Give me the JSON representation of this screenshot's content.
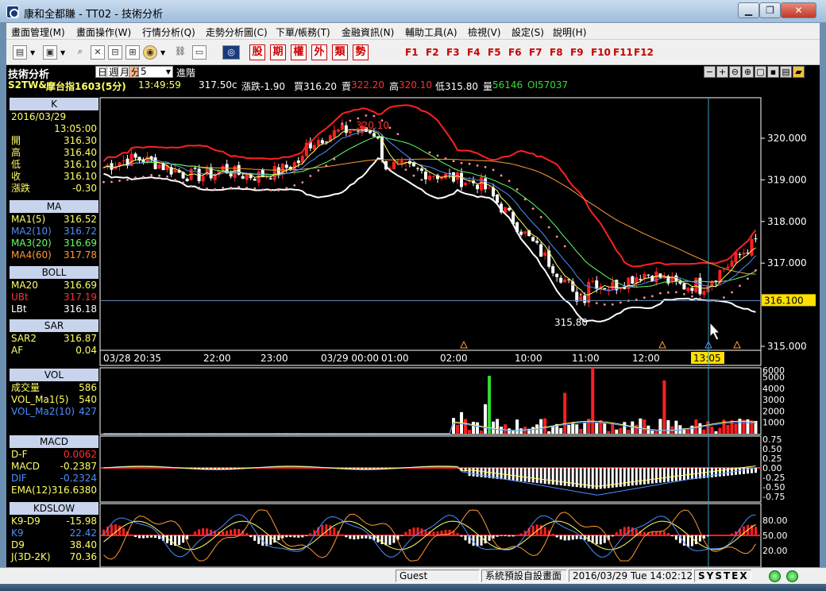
{
  "window": {
    "title": "康和全都賺 - TT02 - 技術分析"
  },
  "menu": [
    "畫面管理(M)",
    "畫面操作(W)",
    "行情分析(Q)",
    "走勢分析圖(C)",
    "下單/帳務(T)",
    "金融資訊(N)",
    "輔助工具(A)",
    "檢視(V)",
    "設定(S)",
    "說明(H)"
  ],
  "toolbar": {
    "red_buttons": [
      "股",
      "期",
      "權",
      "外",
      "類",
      "勢"
    ],
    "fkeys": [
      "F1",
      "F2",
      "F3",
      "F4",
      "F5",
      "F6",
      "F7",
      "F8",
      "F9",
      "F10",
      "F11",
      "F12"
    ]
  },
  "chart_header": {
    "label": "技術分析",
    "periods": [
      "日",
      "週",
      "月",
      "分"
    ],
    "active_period": "分",
    "period_value": "5",
    "advanced": "進階"
  },
  "quote": {
    "symbol": "S2TW&",
    "name": "摩台指1603(5分)",
    "time": "13:49:59",
    "price": "317.50c",
    "change": "漲跌-1.90",
    "bid": "買316.20",
    "ask_label": "賣",
    "ask": "322.20",
    "high_label": "高",
    "high": "320.10",
    "low": "低315.80",
    "vol_label": "量",
    "vol": "56146",
    "oi": "OI57037"
  },
  "left_panel": {
    "k": {
      "title": "K",
      "date": "2016/03/29",
      "time": "13:05:00",
      "rows": [
        {
          "k": "開",
          "v": "316.30"
        },
        {
          "k": "高",
          "v": "316.40"
        },
        {
          "k": "低",
          "v": "316.10"
        },
        {
          "k": "收",
          "v": "316.10"
        },
        {
          "k": "漲跌",
          "v": "-0.30"
        }
      ]
    },
    "ma": {
      "title": "MA",
      "rows": [
        {
          "k": "MA1(5)",
          "v": "316.52",
          "color": "#ffff66"
        },
        {
          "k": "MA2(10)",
          "v": "316.72",
          "color": "#4a8fff"
        },
        {
          "k": "MA3(20)",
          "v": "316.69",
          "color": "#66ff66"
        },
        {
          "k": "MA4(60)",
          "v": "317.78",
          "color": "#ff9933"
        }
      ]
    },
    "boll": {
      "title": "BOLL",
      "rows": [
        {
          "k": "MA20",
          "v": "316.69",
          "color": "#ffff66"
        },
        {
          "k": "UBt",
          "v": "317.19",
          "color": "#ff3030"
        },
        {
          "k": "LBt",
          "v": "316.18",
          "color": "#ffffff"
        }
      ]
    },
    "sar": {
      "title": "SAR",
      "rows": [
        {
          "k": "SAR2",
          "v": "316.87",
          "color": "#ffff66"
        },
        {
          "k": "AF",
          "v": "0.04",
          "color": "#ffff66"
        }
      ]
    },
    "vol": {
      "title": "VOL",
      "rows": [
        {
          "k": "成交量",
          "v": "586",
          "color": "#ffff66"
        },
        {
          "k": "VOL_Ma1(5)",
          "v": "540",
          "color": "#ffff66"
        },
        {
          "k": "VOL_Ma2(10)",
          "v": "427",
          "color": "#4a8fff"
        }
      ]
    },
    "macd": {
      "title": "MACD",
      "rows": [
        {
          "k": "D-F",
          "v": "0.0062",
          "color": "#ff3030"
        },
        {
          "k": "MACD",
          "v": "-0.2387",
          "color": "#ffff66"
        },
        {
          "k": "DIF",
          "v": "-0.2324",
          "color": "#4a8fff"
        },
        {
          "k": "EMA(12)",
          "v": "316.6380",
          "color": "#ffff66"
        }
      ]
    },
    "kd": {
      "title": "KDSLOW",
      "rows": [
        {
          "k": "K9-D9",
          "v": "-15.98",
          "color": "#ffff66"
        },
        {
          "k": "K9",
          "v": "22.42",
          "color": "#4a8fff"
        },
        {
          "k": "D9",
          "v": "38.40",
          "color": "#ffff66"
        },
        {
          "k": "J(3D-2K)",
          "v": "70.36",
          "color": "#ffff66"
        }
      ]
    }
  },
  "price_chart": {
    "y_ticks": [
      "320.000",
      "319.000",
      "318.000",
      "317.000",
      "316.100",
      "315.000"
    ],
    "current_price_label": "316.100",
    "x_ticks": [
      "03/28 20:35",
      "22:00",
      "23:00",
      "03/29 00:00",
      "01:00",
      "02:00",
      "10:00",
      "11:00",
      "12:00",
      "13:05"
    ],
    "high_label": "320.10",
    "low_label": "315.80"
  },
  "vol_chart": {
    "y_ticks": [
      "6000",
      "5000",
      "4000",
      "3000",
      "2000",
      "1000"
    ]
  },
  "macd_chart": {
    "y_ticks": [
      "0.75",
      "0.50",
      "0.25",
      "0.00",
      "-0.25",
      "-0.50",
      "-0.75"
    ]
  },
  "kd_chart": {
    "y_ticks": [
      "80.00",
      "50.00",
      "20.00"
    ]
  },
  "status": {
    "user": "Guest",
    "layout": "系統預設自設畫面",
    "datetime": "2016/03/29 Tue 14:02:12",
    "brand": "SYSTEX"
  },
  "colors": {
    "up": "#ff2020",
    "down": "#ffffff",
    "up_vol": "#33dd33",
    "bg": "#000000"
  }
}
